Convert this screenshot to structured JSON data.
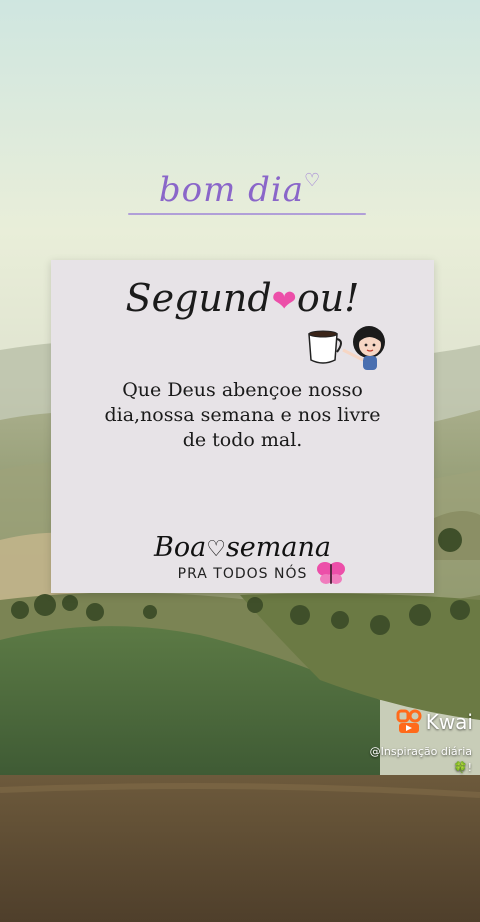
{
  "greeting": {
    "text": "bom dia",
    "heart": "♡"
  },
  "card": {
    "title_part1": "Segund",
    "title_heart": "❤",
    "title_part2": "ou!",
    "message": "Que Deus abençoe nosso dia,nossa semana e nos livre de todo mal.",
    "closing_part1": "Boa",
    "closing_heart": "♡",
    "closing_part2": "semana",
    "subline": "PRA TODOS NÓS"
  },
  "watermark": {
    "brand": "Kwai",
    "handle": "@Inspiração diária🍀!"
  },
  "colors": {
    "accent": "#8a66c9",
    "heart_pink": "#ec4fa9",
    "kwai_orange": "#ff6a1a",
    "card_bg": "#e7e3e7"
  },
  "icons": [
    "coffee-cup-icon",
    "girl-cartoon-icon",
    "butterfly-icon",
    "kwai-logo-icon"
  ]
}
